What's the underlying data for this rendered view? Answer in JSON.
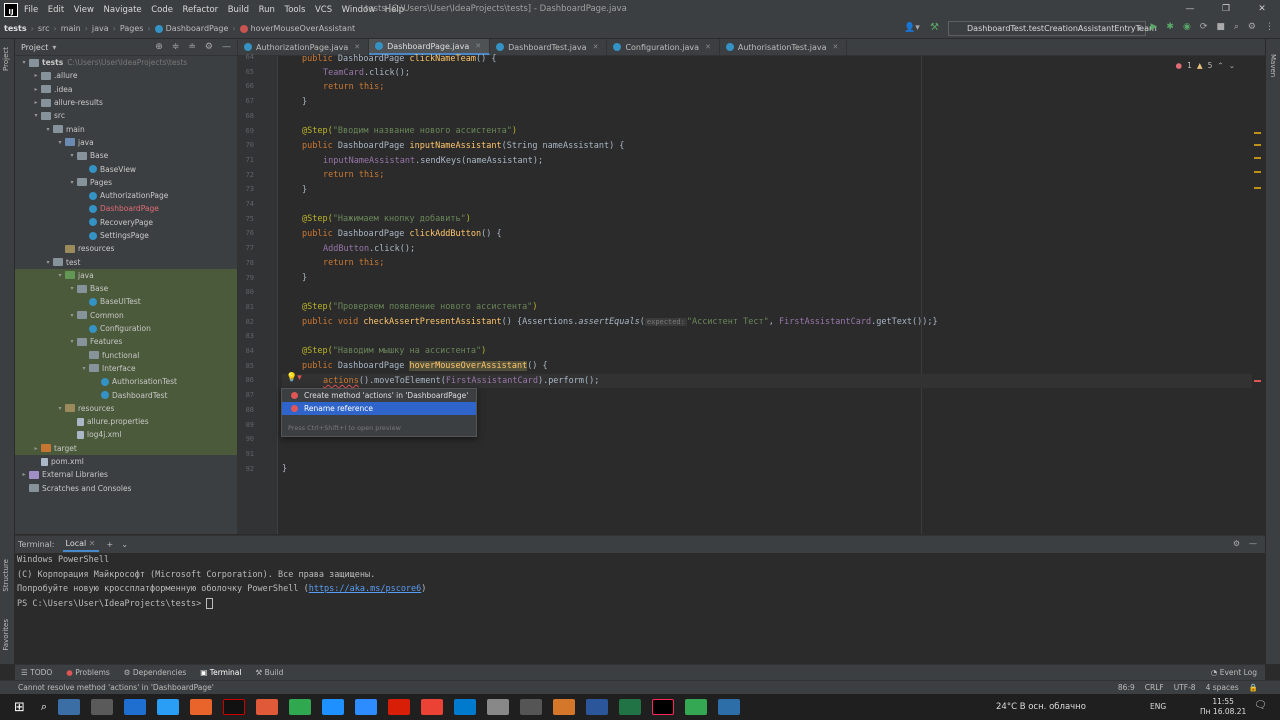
{
  "window": {
    "menu": [
      "File",
      "Edit",
      "View",
      "Navigate",
      "Code",
      "Refactor",
      "Build",
      "Run",
      "Tools",
      "VCS",
      "Window",
      "Help"
    ],
    "title": "tests [C:\\Users\\User\\IdeaProjects\\tests] - DashboardPage.java",
    "controls": [
      "—",
      "❐",
      "✕"
    ]
  },
  "breadcrumbs": [
    "tests",
    "src",
    "main",
    "java",
    "Pages",
    "DashboardPage",
    "hoverMouseOverAssistant"
  ],
  "run_config": "DashboardTest.testCreationAssistantEntryTeam",
  "project_panel": {
    "title": "Project",
    "tree": [
      {
        "label": "tests",
        "note": "C:\\Users\\User\\IdeaProjects\\tests",
        "depth": 0,
        "arrow": "▾",
        "icon": "folder",
        "bold": true
      },
      {
        "label": ".allure",
        "depth": 1,
        "arrow": "▸",
        "icon": "folder"
      },
      {
        "label": ".idea",
        "depth": 1,
        "arrow": "▸",
        "icon": "folder"
      },
      {
        "label": "allure-results",
        "depth": 1,
        "arrow": "▸",
        "icon": "folder"
      },
      {
        "label": "src",
        "depth": 1,
        "arrow": "▾",
        "icon": "folder"
      },
      {
        "label": "main",
        "depth": 2,
        "arrow": "▾",
        "icon": "folder"
      },
      {
        "label": "java",
        "depth": 3,
        "arrow": "▾",
        "icon": "jfolder"
      },
      {
        "label": "Base",
        "depth": 4,
        "arrow": "▾",
        "icon": "folder"
      },
      {
        "label": "BaseView",
        "depth": 5,
        "arrow": "",
        "icon": "cls"
      },
      {
        "label": "Pages",
        "depth": 4,
        "arrow": "▾",
        "icon": "folder"
      },
      {
        "label": "AuthorizationPage",
        "depth": 5,
        "arrow": "",
        "icon": "cls"
      },
      {
        "label": "DashboardPage",
        "depth": 5,
        "arrow": "",
        "icon": "cls",
        "error": true
      },
      {
        "label": "RecoveryPage",
        "depth": 5,
        "arrow": "",
        "icon": "cls"
      },
      {
        "label": "SettingsPage",
        "depth": 5,
        "arrow": "",
        "icon": "cls"
      },
      {
        "label": "resources",
        "depth": 3,
        "arrow": "",
        "icon": "rfolder"
      },
      {
        "label": "test",
        "depth": 2,
        "arrow": "▾",
        "icon": "folder"
      },
      {
        "label": "java",
        "depth": 3,
        "arrow": "▾",
        "icon": "tfolder",
        "hl": true
      },
      {
        "label": "Base",
        "depth": 4,
        "arrow": "▾",
        "icon": "folder",
        "hl": true
      },
      {
        "label": "BaseUITest",
        "depth": 5,
        "arrow": "",
        "icon": "cls",
        "hl": true
      },
      {
        "label": "Common",
        "depth": 4,
        "arrow": "▾",
        "icon": "folder",
        "hl": true
      },
      {
        "label": "Configuration",
        "depth": 5,
        "arrow": "",
        "icon": "cls",
        "hl": true
      },
      {
        "label": "Features",
        "depth": 4,
        "arrow": "▾",
        "icon": "folder",
        "hl": true
      },
      {
        "label": "functional",
        "depth": 5,
        "arrow": "",
        "icon": "folder",
        "hl": true
      },
      {
        "label": "Interface",
        "depth": 5,
        "arrow": "▾",
        "icon": "folder",
        "hl": true
      },
      {
        "label": "AuthorisationTest",
        "depth": 6,
        "arrow": "",
        "icon": "cls",
        "hl": true
      },
      {
        "label": "DashboardTest",
        "depth": 6,
        "arrow": "",
        "icon": "cls",
        "hl": true
      },
      {
        "label": "resources",
        "depth": 3,
        "arrow": "▾",
        "icon": "rfolder",
        "hl": true
      },
      {
        "label": "allure.properties",
        "depth": 4,
        "arrow": "",
        "icon": "file",
        "hl": true
      },
      {
        "label": "log4j.xml",
        "depth": 4,
        "arrow": "",
        "icon": "file",
        "hl": true
      },
      {
        "label": "target",
        "depth": 1,
        "arrow": "▸",
        "icon": "orange",
        "hl": true
      },
      {
        "label": "pom.xml",
        "depth": 1,
        "arrow": "",
        "icon": "file"
      },
      {
        "label": "External Libraries",
        "depth": 0,
        "arrow": "▸",
        "icon": "lib"
      },
      {
        "label": "Scratches and Consoles",
        "depth": 0,
        "arrow": "",
        "icon": "folder"
      }
    ]
  },
  "tabs": [
    {
      "label": "AuthorizationPage.java",
      "active": false
    },
    {
      "label": "DashboardPage.java",
      "active": true
    },
    {
      "label": "DashboardTest.java",
      "active": false
    },
    {
      "label": "Configuration.java",
      "active": false
    },
    {
      "label": "AuthorisationTest.java",
      "active": false
    }
  ],
  "editor": {
    "error_count": "1",
    "warning_count": "5",
    "line_numbers": [
      "64",
      "65",
      "66",
      "67",
      "68",
      "69",
      "70",
      "71",
      "72",
      "73",
      "74",
      "75",
      "76",
      "77",
      "78",
      "79",
      "80",
      "81",
      "82",
      "83",
      "84",
      "85",
      "86",
      "87",
      "88",
      "89",
      "90",
      "91",
      "92"
    ],
    "code": {
      "l64a": "public ",
      "l64b": "DashboardPage ",
      "l64c": "clickNameTeam",
      "l64d": "() {",
      "l65a": "TeamCard",
      "l65b": ".click();",
      "l66": "return this;",
      "l67": "}",
      "l69a": "@Step(",
      "l69b": "\"Вводим название нового ассистента\"",
      "l69c": ")",
      "l70a": "public ",
      "l70b": "DashboardPage ",
      "l70c": "inputNameAssistant",
      "l70d": "(String nameAssistant) {",
      "l71a": "inputNameAssistant",
      "l71b": ".sendKeys(nameAssistant);",
      "l72": "return this;",
      "l73": "}",
      "l75a": "@Step(",
      "l75b": "\"Нажимаем кнопку добавить\"",
      "l75c": ")",
      "l76a": "public ",
      "l76b": "DashboardPage ",
      "l76c": "clickAddButton",
      "l76d": "() {",
      "l77a": "AddButton",
      "l77b": ".click();",
      "l78": "return this;",
      "l79": "}",
      "l81a": "@Step(",
      "l81b": "\"Проверяем появление нового ассистента\"",
      "l81c": ")",
      "l82a": "public void ",
      "l82b": "checkAssertPresentAssistant",
      "l82c": "() {Assertions.",
      "l82d": "assertEquals",
      "l82e": "(",
      "l82hint": "expected:",
      "l82f": "\"Ассистент Тест\"",
      "l82g": ", ",
      "l82h": "FirstAssistantCard",
      "l82i": ".getText());}",
      "l84a": "@Step(",
      "l84b": "\"Наводим мышку на ассистента\"",
      "l84c": ")",
      "l85a": "public ",
      "l85b": "DashboardPage ",
      "l85c": "hoverMouseOverAssistant",
      "l85d": "() {",
      "l86a": "actions",
      "l86b": "().moveToElement(",
      "l86c": "FirstAssistantCard",
      "l86d": ").perform();",
      "l92": "}"
    }
  },
  "popup": {
    "items": [
      "Create method 'actions' in 'DashboardPage'",
      "Rename reference"
    ],
    "footer": "Press Ctrl+Shift+I to open preview"
  },
  "terminal": {
    "label": "Terminal:",
    "tab": "Local",
    "lines": [
      "Windows PowerShell",
      "(C) Корпорация Майкрософт (Microsoft Corporation). Все права защищены.",
      "Попробуйте новую кроссплатформенную оболочку PowerShell (",
      "PS C:\\Users\\User\\IdeaProjects\\tests> "
    ],
    "link": "https://aka.ms/pscore6",
    "link_suffix": ")"
  },
  "tool_tabs": [
    "TODO",
    "Problems",
    "Dependencies",
    "Terminal",
    "Build"
  ],
  "event_log": "Event Log",
  "side_labels": {
    "project": "Project",
    "structure": "Structure",
    "favorites": "Favorites",
    "maven": "Maven"
  },
  "status": {
    "message": "Cannot resolve method 'actions' in 'DashboardPage'",
    "position": "86:9",
    "line_sep": "CRLF",
    "encoding": "UTF-8",
    "indent": "4 spaces"
  },
  "taskbar": {
    "weather": "24°C  В осн. облачно",
    "lang": "ENG",
    "time": "11:55",
    "date": "Пн 16.08.21"
  }
}
